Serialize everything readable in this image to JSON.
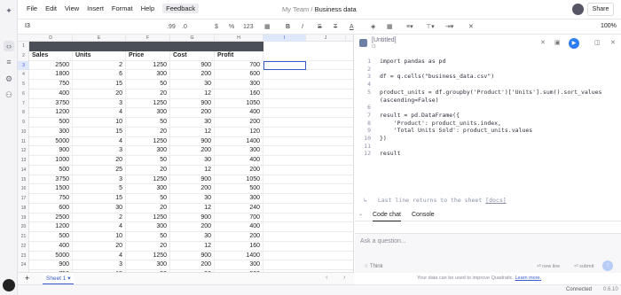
{
  "app": {
    "menu": [
      "File",
      "Edit",
      "View",
      "Insert",
      "Format",
      "Help",
      "Feedback"
    ],
    "breadcrumb": {
      "team": "My Team",
      "separator": "/",
      "file": "Business data"
    },
    "share_label": "Share"
  },
  "toolbar": {
    "cell_ref": "I3",
    "buttons": [
      ".99",
      ".0",
      "$",
      "%",
      "123"
    ],
    "zoom": "100%"
  },
  "grid": {
    "columns": [
      "D",
      "E",
      "F",
      "G",
      "H",
      "I",
      "J",
      "K"
    ],
    "selected_column": "I",
    "row_numbers": [
      "1",
      "2",
      "3",
      "4",
      "5",
      "6",
      "7",
      "8",
      "9",
      "10",
      "11",
      "12",
      "13",
      "14",
      "15",
      "16",
      "17",
      "18",
      "19",
      "20",
      "21",
      "22",
      "23",
      "24",
      "25"
    ],
    "selected_row": "3",
    "header": [
      "Sales",
      "Units",
      "Price",
      "Cost",
      "Profit"
    ],
    "rows": [
      [
        "2500",
        "2",
        "1250",
        "900",
        "700"
      ],
      [
        "1800",
        "6",
        "300",
        "200",
        "600"
      ],
      [
        "750",
        "15",
        "50",
        "30",
        "300"
      ],
      [
        "400",
        "20",
        "20",
        "12",
        "160"
      ],
      [
        "3750",
        "3",
        "1250",
        "900",
        "1050"
      ],
      [
        "1200",
        "4",
        "300",
        "200",
        "400"
      ],
      [
        "500",
        "10",
        "50",
        "30",
        "200"
      ],
      [
        "300",
        "15",
        "20",
        "12",
        "120"
      ],
      [
        "5000",
        "4",
        "1250",
        "900",
        "1400"
      ],
      [
        "900",
        "3",
        "300",
        "200",
        "300"
      ],
      [
        "1000",
        "20",
        "50",
        "30",
        "400"
      ],
      [
        "500",
        "25",
        "20",
        "12",
        "200"
      ],
      [
        "3750",
        "3",
        "1250",
        "900",
        "1050"
      ],
      [
        "1500",
        "5",
        "300",
        "200",
        "500"
      ],
      [
        "750",
        "15",
        "50",
        "30",
        "300"
      ],
      [
        "600",
        "30",
        "20",
        "12",
        "240"
      ],
      [
        "2500",
        "2",
        "1250",
        "900",
        "700"
      ],
      [
        "1200",
        "4",
        "300",
        "200",
        "400"
      ],
      [
        "500",
        "10",
        "50",
        "30",
        "200"
      ],
      [
        "400",
        "20",
        "20",
        "12",
        "160"
      ],
      [
        "5000",
        "4",
        "1250",
        "900",
        "1400"
      ],
      [
        "900",
        "3",
        "300",
        "200",
        "300"
      ],
      [
        "750",
        "15",
        "50",
        "30",
        "300"
      ]
    ]
  },
  "sheets": {
    "add": "+",
    "active": "Sheet 1 ▾"
  },
  "status": {
    "connection": "Connected",
    "version": "0.6.10"
  },
  "panel": {
    "title": "[Untitled]",
    "cell": "I3",
    "code_lines": [
      "import pandas as pd",
      "",
      "df = q.cells(\"business_data.csv\")",
      "",
      "product_units = df.groupby('Product')['Units'].sum().sort_values",
      "(ascending=False)",
      "",
      "result = pd.DataFrame({",
      "    'Product': product_units.index,",
      "    'Total Units Sold': product_units.values",
      "})",
      "",
      "result"
    ],
    "line_numbers": [
      "1",
      "2",
      "3",
      "4",
      "5",
      "",
      "6",
      "7",
      "8",
      "9",
      "10",
      "11",
      "12"
    ],
    "last_line_note": "Last line returns to the sheet",
    "docs": "[docs]",
    "tabs": [
      "Code chat",
      "Console"
    ],
    "ask_placeholder": "Ask a question...",
    "think": "Think",
    "new_line": "⏎ new line",
    "submit": "⏎ submit",
    "notice": "Your data can be used to improve Quadratic.",
    "learn_more": "Learn more."
  }
}
